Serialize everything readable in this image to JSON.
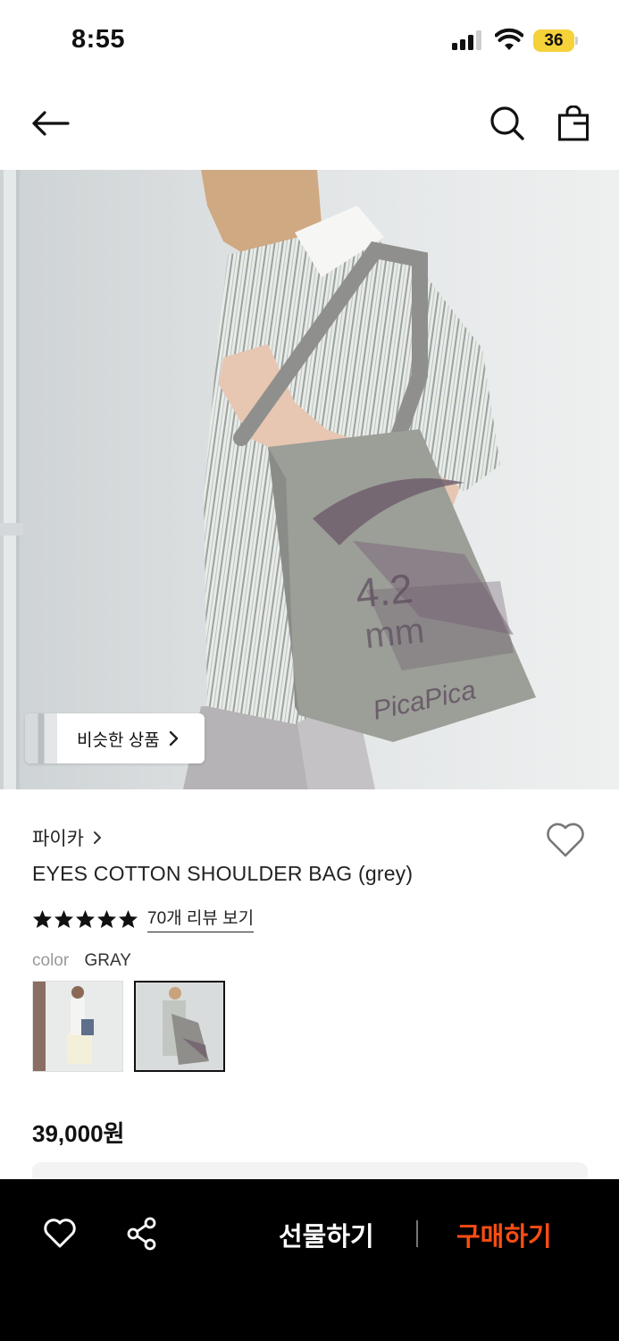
{
  "status_bar": {
    "time": "8:55",
    "battery": "36"
  },
  "nav": {
    "back_icon": "arrow-left-icon",
    "search_icon": "search-icon",
    "bag_icon": "shopping-bag-icon"
  },
  "similar": {
    "label": "비슷한 상품"
  },
  "product": {
    "brand": "파이카",
    "title": "EYES COTTON SHOULDER BAG (grey)",
    "rating": 5,
    "review_link": "70개 리뷰 보기",
    "color_label": "color",
    "color_value": "GRAY",
    "price": "39,000원"
  },
  "bottom_bar": {
    "gift_label": "선물하기",
    "buy_label": "구매하기"
  },
  "colors": {
    "accent": "#ff4d12",
    "star": "#111111",
    "battery": "#f5d13a"
  }
}
